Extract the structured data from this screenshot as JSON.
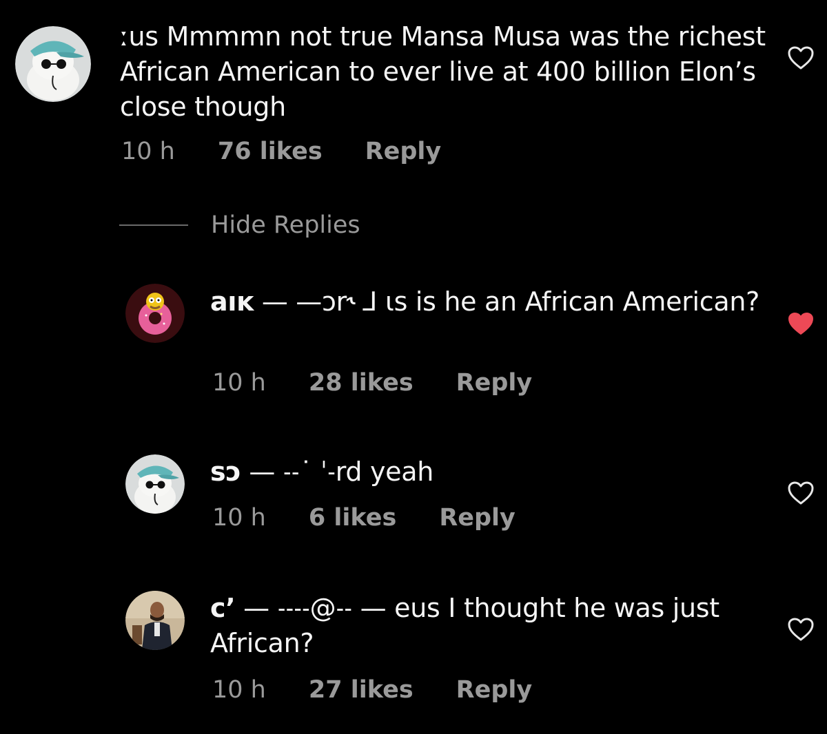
{
  "comments": [
    {
      "user": "",
      "text": "ːus Mmmmn not true Mansa Musa was the richest African American to ever live at 400 billion Elon’s close though",
      "time": "10 h",
      "likes": "76 likes",
      "reply": "Reply",
      "liked": false,
      "avatar": "cat-with-cap-avatar"
    },
    {
      "user": "aıĸ",
      "text": "— —ɔr˞ ⅃ ɩs is he an African American?",
      "time": "10 h",
      "likes": "28 likes",
      "reply": "Reply",
      "liked": true,
      "avatar": "donut-character-avatar"
    },
    {
      "user": "sɔ",
      "text": "— ˗˗˙ ˈ˗rd yeah",
      "time": "10 h",
      "likes": "6 likes",
      "reply": "Reply",
      "liked": false,
      "avatar": "cat-with-cap-avatar"
    },
    {
      "user": "cʼ",
      "text": "— ˗˗˗˗@˗˗ — eus I thought he was just African?",
      "time": "10 h",
      "likes": "27 likes",
      "reply": "Reply",
      "liked": false,
      "avatar": "man-photo-avatar"
    }
  ],
  "hide_replies_label": "Hide Replies",
  "colors": {
    "background": "#000000",
    "text": "#f5f5f5",
    "meta": "#9a9a9a",
    "heart_liked": "#ed4956",
    "heart_outline": "#e8e8e8"
  },
  "icons": {
    "like": "heart-outline-icon",
    "liked": "heart-filled-icon"
  }
}
